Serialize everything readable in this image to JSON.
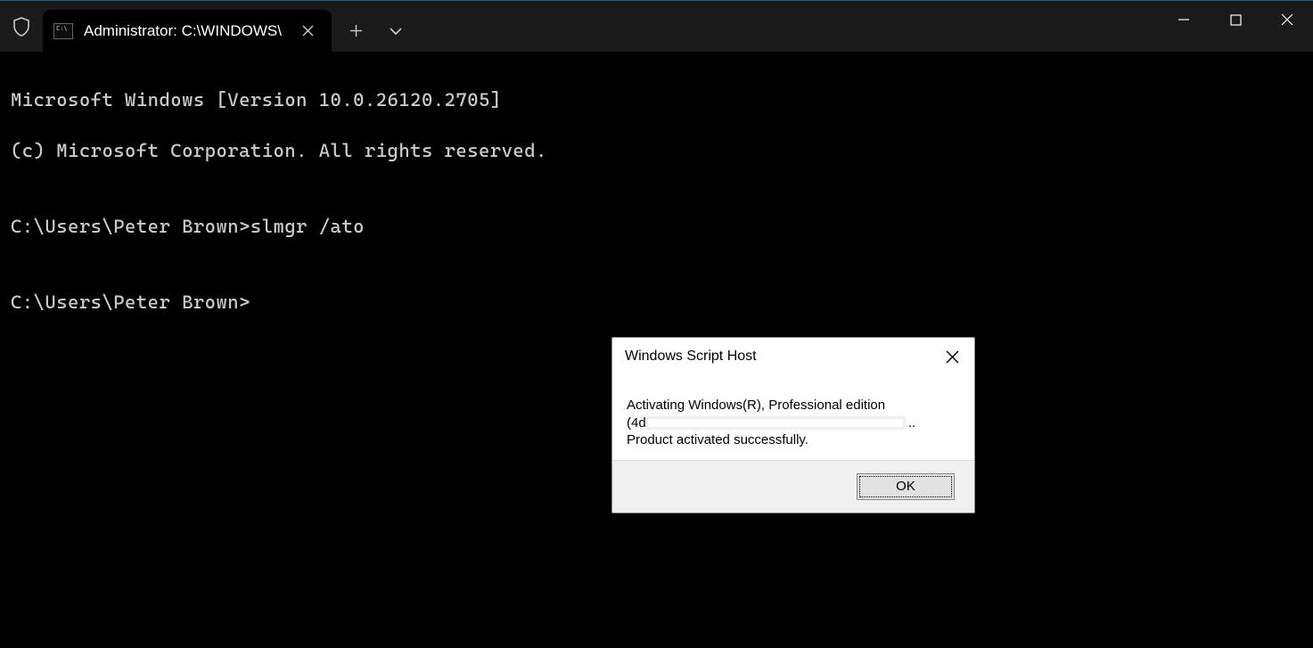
{
  "titlebar": {
    "tab_title": "Administrator: C:\\WINDOWS\\",
    "tab_icon_text": ">_"
  },
  "terminal": {
    "line1": "Microsoft Windows [Version 10.0.26120.2705]",
    "line2": "(c) Microsoft Corporation. All rights reserved.",
    "line3": "",
    "line4": "C:\\Users\\Peter Brown>slmgr /ato",
    "line5": "",
    "line6": "C:\\Users\\Peter Brown>"
  },
  "dialog": {
    "title": "Windows Script Host",
    "body_line1": "Activating Windows(R), Professional edition",
    "body_line2_prefix": "(4d",
    "body_line2_suffix": " ..",
    "body_line3": "Product activated successfully.",
    "ok_label": "OK"
  }
}
